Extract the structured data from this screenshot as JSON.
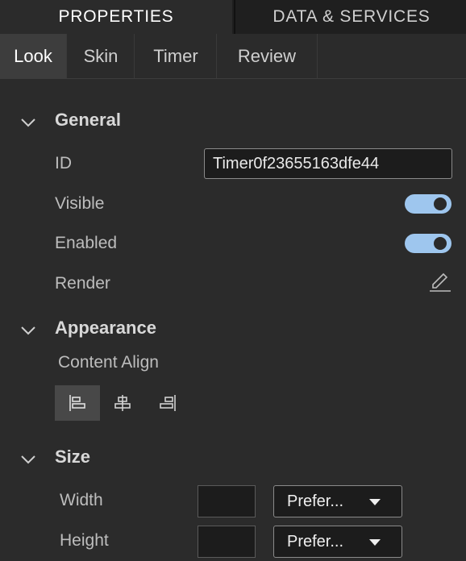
{
  "top_tabs": [
    "PROPERTIES",
    "DATA & SERVICES"
  ],
  "sub_tabs": [
    "Look",
    "Skin",
    "Timer",
    "Review"
  ],
  "general": {
    "title": "General",
    "id_label": "ID",
    "id_value": "Timer0f23655163dfe44",
    "visible_label": "Visible",
    "visible_on": true,
    "enabled_label": "Enabled",
    "enabled_on": true,
    "render_label": "Render",
    "render_icon": "pencil-icon"
  },
  "appearance": {
    "title": "Appearance",
    "content_align_label": "Content Align",
    "align_options": [
      "align-left-icon",
      "align-center-icon",
      "align-right-icon"
    ],
    "selected_align": "align-left-icon"
  },
  "size": {
    "title": "Size",
    "width_label": "Width",
    "width_value": "",
    "width_mode": "Prefer...",
    "height_label": "Height",
    "height_value": "",
    "height_mode": "Prefer..."
  },
  "colors": {
    "toggle_on": "#9ec6ee",
    "background": "#2b2b2b",
    "tab_bar": "#1f1f1f"
  }
}
